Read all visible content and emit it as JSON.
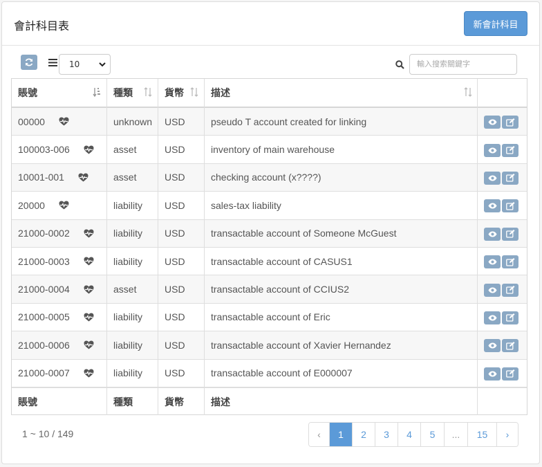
{
  "header": {
    "title": "會計科目表",
    "new_button": "新會計科目"
  },
  "toolbar": {
    "page_size": "10",
    "search_placeholder": "輸入搜索關鍵字"
  },
  "columns": {
    "account": "賬號",
    "type": "種類",
    "currency": "貨幣",
    "description": "描述"
  },
  "rows": [
    {
      "account": "00000",
      "type": "unknown",
      "currency": "USD",
      "description": "pseudo T account created for linking"
    },
    {
      "account": "100003-006",
      "type": "asset",
      "currency": "USD",
      "description": "inventory of main warehouse"
    },
    {
      "account": "10001-001",
      "type": "asset",
      "currency": "USD",
      "description": "checking account (x????)"
    },
    {
      "account": "20000",
      "type": "liability",
      "currency": "USD",
      "description": "sales-tax liability"
    },
    {
      "account": "21000-0002",
      "type": "liability",
      "currency": "USD",
      "description": "transactable account of Someone McGuest"
    },
    {
      "account": "21000-0003",
      "type": "liability",
      "currency": "USD",
      "description": "transactable account of CASUS1"
    },
    {
      "account": "21000-0004",
      "type": "asset",
      "currency": "USD",
      "description": "transactable account of CCIUS2"
    },
    {
      "account": "21000-0005",
      "type": "liability",
      "currency": "USD",
      "description": "transactable account of Eric"
    },
    {
      "account": "21000-0006",
      "type": "liability",
      "currency": "USD",
      "description": "transactable account of Xavier Hernandez"
    },
    {
      "account": "21000-0007",
      "type": "liability",
      "currency": "USD",
      "description": "transactable account of E000007"
    }
  ],
  "summary": "1 ~ 10 / 149",
  "pagination": {
    "prev": "‹",
    "pages": [
      "1",
      "2",
      "3",
      "4",
      "5",
      "...",
      "15"
    ],
    "next": "›",
    "current": "1"
  },
  "icons": {
    "refresh": "refresh-icon",
    "list": "list-icon",
    "search": "search-icon",
    "heart": "heartbeat-icon",
    "view": "eye-icon",
    "edit": "edit-icon"
  },
  "colors": {
    "primary": "#5b9ad8",
    "action_button": "#8aa8c4"
  }
}
